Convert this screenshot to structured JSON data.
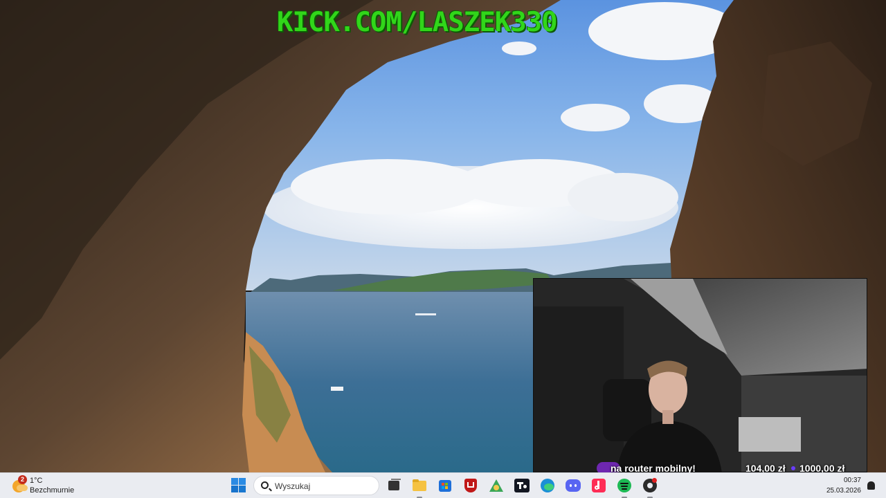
{
  "overlay": {
    "stream_url": "KICK.COM/LASZEK330"
  },
  "donation_goal": {
    "message": "na router mobilny!",
    "current_amount": "104,00 zł",
    "goal_amount": "1000,00 zł",
    "progress_fraction": 0.104
  },
  "taskbar": {
    "weather": {
      "temperature": "1°C",
      "condition": "Bezchmurnie",
      "badge_count": "2"
    },
    "search": {
      "placeholder": "Wyszukaj"
    },
    "pinned_apps": [
      {
        "name": "task-view",
        "color": "#333333"
      },
      {
        "name": "file-explorer",
        "color": "#f5c242"
      },
      {
        "name": "microsoft-store",
        "color": "#1e6fd9"
      },
      {
        "name": "mcafee",
        "color": "#c01818"
      },
      {
        "name": "recycle-app",
        "color": "#3aa757"
      },
      {
        "name": "tradingview",
        "color": "#131722"
      },
      {
        "name": "edge",
        "color": "#1b8fd6"
      },
      {
        "name": "discord",
        "color": "#5865f2"
      },
      {
        "name": "tiktok",
        "color": "#fe2c55"
      },
      {
        "name": "spotify",
        "color": "#1db954"
      },
      {
        "name": "obs",
        "color": "#2b2b2b"
      }
    ],
    "clock": {
      "time": "00:37",
      "date": "25.03.2026"
    }
  },
  "colors": {
    "overlay_green": "#31d61a",
    "taskbar_bg": "#eaecf1",
    "goal_accent": "#8a2be2"
  }
}
